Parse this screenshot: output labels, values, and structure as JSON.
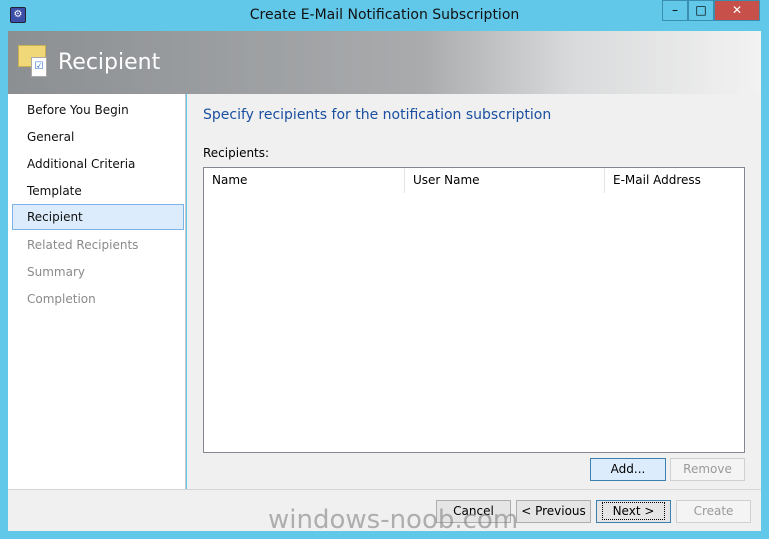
{
  "window": {
    "title": "Create E-Mail Notification Subscription",
    "min": "–",
    "max": "□",
    "close": "✕",
    "icon": "app-icon"
  },
  "header": {
    "title": "Recipient",
    "icon": "email-checklist-icon"
  },
  "nav": {
    "items": [
      {
        "label": "Before You Begin",
        "state": "normal"
      },
      {
        "label": "General",
        "state": "normal"
      },
      {
        "label": "Additional Criteria",
        "state": "normal"
      },
      {
        "label": "Template",
        "state": "normal"
      },
      {
        "label": "Recipient",
        "state": "selected"
      },
      {
        "label": "Related Recipients",
        "state": "disabled"
      },
      {
        "label": "Summary",
        "state": "disabled"
      },
      {
        "label": "Completion",
        "state": "disabled"
      }
    ]
  },
  "main": {
    "title": "Specify recipients for the notification subscription",
    "recipients_label": "Recipients:",
    "columns": [
      "Name",
      "User Name",
      "E-Mail Address"
    ],
    "rows": [],
    "add": "Add...",
    "remove": "Remove"
  },
  "footer": {
    "cancel": "Cancel",
    "previous": "< Previous",
    "next": "Next >",
    "create": "Create"
  },
  "watermark": "windows-noob.com",
  "colors": {
    "titlebar": "#62c8ea",
    "accent_text": "#1b4fa0",
    "selected": "#dcecfc"
  }
}
